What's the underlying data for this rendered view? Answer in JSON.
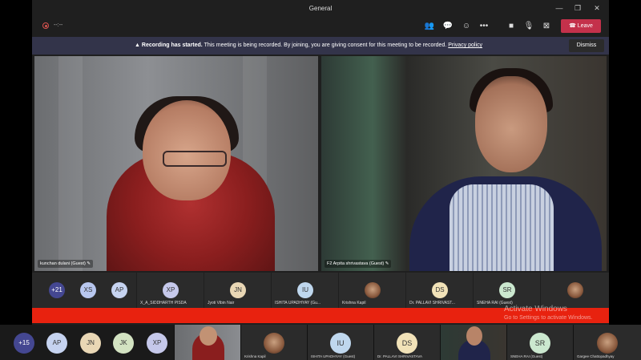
{
  "window": {
    "title": "General"
  },
  "toolbar": {
    "timer": "--:--",
    "leave_label": "Leave"
  },
  "banner": {
    "bold": "Recording has started.",
    "text": " This meeting is being recorded. By joining, you are giving consent for this meeting to be recorded. ",
    "link": "Privacy policy",
    "dismiss": "Dismiss"
  },
  "videos": [
    {
      "name": "kunchan dulani (Guest)"
    },
    {
      "name": "F2 Arpita shrivastava (Guest)"
    }
  ],
  "strip": {
    "overflow": "+21",
    "initials": [
      "XS",
      "AP"
    ],
    "tiles": [
      {
        "initials": "XP",
        "name": "X_A_SIDDHARTH PISDA"
      },
      {
        "initials": "JN",
        "name": "Jyoti Vibin Nair"
      },
      {
        "initials": "IU",
        "name": "ISHITA UPADHYAY (Gu..."
      },
      {
        "initials": "",
        "name": "Krishna Kapil"
      },
      {
        "initials": "DS",
        "name": "Dr. PALLAVI SHRIVAST..."
      },
      {
        "initials": "SR",
        "name": "SNEHA RAI (Guest)"
      },
      {
        "initials": "",
        "name": ""
      }
    ]
  },
  "watermark": {
    "line1": "Activate Windows",
    "line2": "Go to Settings to activate Windows."
  },
  "bottom": {
    "overflow": "+15",
    "initials": [
      "AP",
      "JN",
      "JK",
      "XP"
    ],
    "tiles": [
      {
        "initials": "",
        "name": ""
      },
      {
        "initials": "",
        "name": "Krishna Kapil"
      },
      {
        "initials": "IU",
        "name": "ISHITA UPADHYAY (Guest)"
      },
      {
        "initials": "DS",
        "name": "Dr. PALLAVI SHRIVASTAVA"
      },
      {
        "initials": "",
        "name": ""
      },
      {
        "initials": "SR",
        "name": "SNEHA RAI (Guest)"
      },
      {
        "initials": "",
        "name": "Gargee Chattopadhyay"
      }
    ]
  },
  "colors": {
    "leave": "#c4314b",
    "banner": "#33344a",
    "accent": "#444791",
    "red_bar": "#e8220f"
  }
}
